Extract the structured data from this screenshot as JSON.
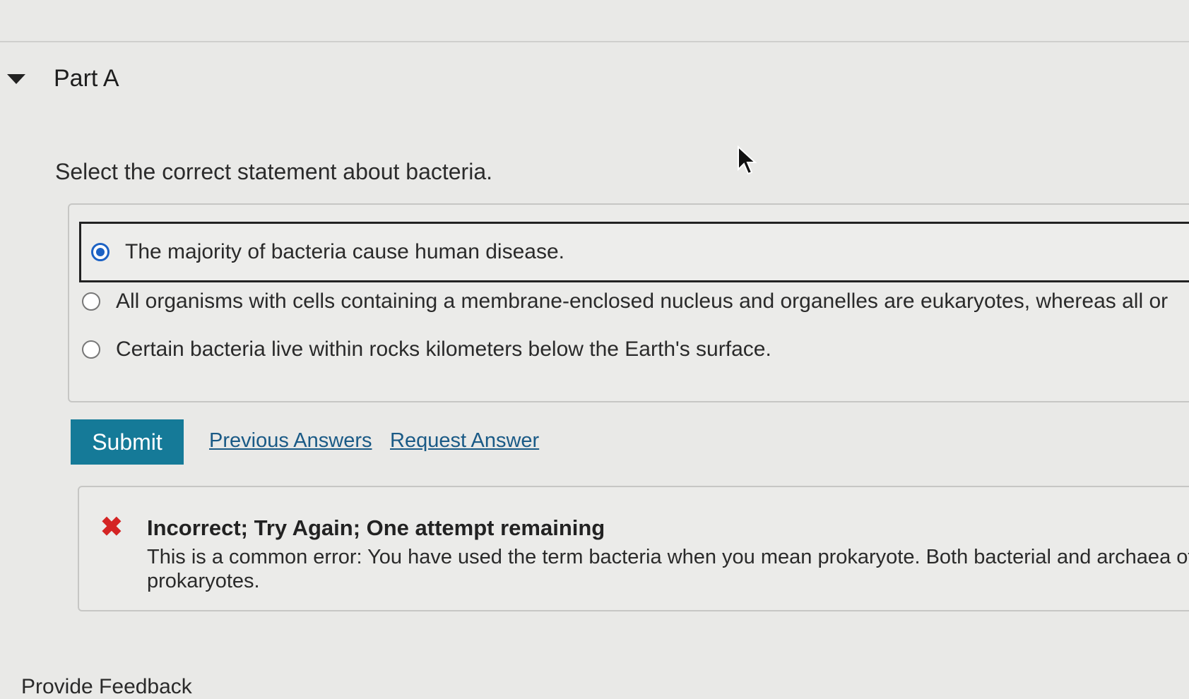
{
  "part": {
    "title": "Part A"
  },
  "question": "Select the correct statement about bacteria.",
  "options": [
    {
      "label": "The majority of bacteria cause human disease.",
      "selected": true
    },
    {
      "label": "All organisms with cells containing a membrane-enclosed nucleus and organelles are eukaryotes, whereas all or",
      "selected": false
    },
    {
      "label": "Certain bacteria live within rocks kilometers below the Earth's surface.",
      "selected": false
    }
  ],
  "actions": {
    "submit": "Submit",
    "previous_answers": "Previous Answers",
    "request_answer": "Request Answer"
  },
  "feedback": {
    "title": "Incorrect; Try Again; One attempt remaining",
    "body": "This is a common error: You have used the term bacteria when you mean prokaryote. Both bacterial and archaea of prokaryotes."
  },
  "footer": {
    "text": "Provide Feedback"
  },
  "colors": {
    "accent": "#157a98",
    "error": "#d42424",
    "radio": "#1c62c4",
    "link": "#1a5a86"
  }
}
